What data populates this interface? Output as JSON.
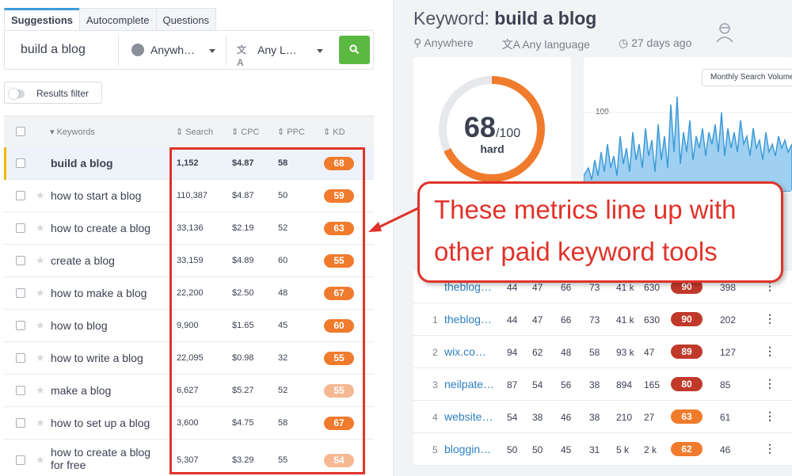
{
  "tabs": [
    "Suggestions",
    "Autocomplete",
    "Questions"
  ],
  "search": {
    "keyword": "build a blog",
    "location": "Anywh…",
    "language": "Any L…"
  },
  "filter_label": "Results filter",
  "table_headers": {
    "keywords": "Keywords",
    "search": "Search",
    "cpc": "CPC",
    "ppc": "PPC",
    "kd": "KD"
  },
  "rows": [
    {
      "keyword": "build a blog",
      "search": "1,152",
      "cpc": "$4.87",
      "ppc": "58",
      "kd": "68"
    },
    {
      "keyword": "how to start a blog",
      "search": "110,387",
      "cpc": "$4.87",
      "ppc": "50",
      "kd": "59"
    },
    {
      "keyword": "how to create a blog",
      "search": "33,136",
      "cpc": "$2.19",
      "ppc": "52",
      "kd": "63"
    },
    {
      "keyword": "create a blog",
      "search": "33,159",
      "cpc": "$4.89",
      "ppc": "60",
      "kd": "55"
    },
    {
      "keyword": "how to make a blog",
      "search": "22,200",
      "cpc": "$2.50",
      "ppc": "48",
      "kd": "67"
    },
    {
      "keyword": "how to blog",
      "search": "9,900",
      "cpc": "$1.65",
      "ppc": "45",
      "kd": "60"
    },
    {
      "keyword": "how to write a blog",
      "search": "22,095",
      "cpc": "$0.98",
      "ppc": "32",
      "kd": "55"
    },
    {
      "keyword": "make a blog",
      "search": "6,627",
      "cpc": "$5.27",
      "ppc": "52",
      "kd": "55"
    },
    {
      "keyword": "how to set up a blog",
      "search": "3,600",
      "cpc": "$4.75",
      "ppc": "58",
      "kd": "67"
    },
    {
      "keyword_line1": "how to create a blog",
      "keyword_line2": "for free",
      "search": "5,307",
      "cpc": "$3.29",
      "ppc": "55",
      "kd": "54"
    }
  ],
  "right": {
    "title_prefix": "Keyword:",
    "title_keyword": "build a blog",
    "location": "Anywhere",
    "language": "Any language",
    "updated": "27 days ago",
    "difficulty": "68",
    "difficulty_max": "/100",
    "difficulty_word": "hard",
    "chart_button": "Monthly Search Volume",
    "chart_tick": "100"
  },
  "serp": [
    {
      "rank": "",
      "domain": "theblog…",
      "v": [
        "44",
        "47",
        "66",
        "73",
        "41 k",
        "630"
      ],
      "badge": "90",
      "last": "398"
    },
    {
      "rank": "1",
      "domain": "theblog…",
      "v": [
        "44",
        "47",
        "66",
        "73",
        "41 k",
        "630"
      ],
      "badge": "90",
      "last": "202"
    },
    {
      "rank": "2",
      "domain": "wix.co…",
      "v": [
        "94",
        "62",
        "48",
        "58",
        "93 k",
        "47"
      ],
      "badge": "89",
      "last": "127"
    },
    {
      "rank": "3",
      "domain": "neilpate…",
      "v": [
        "87",
        "54",
        "56",
        "38",
        "894",
        "165"
      ],
      "badge": "80",
      "last": "85"
    },
    {
      "rank": "4",
      "domain": "website…",
      "v": [
        "54",
        "38",
        "46",
        "38",
        "210",
        "27"
      ],
      "badge": "63",
      "last": "61"
    },
    {
      "rank": "5",
      "domain": "bloggin…",
      "v": [
        "50",
        "50",
        "45",
        "31",
        "5 k",
        "2 k"
      ],
      "badge": "62",
      "last": "46"
    }
  ],
  "callout": {
    "line1": "These metrics line up with",
    "line2": "other paid keyword tools"
  },
  "colors": {
    "green": "#5bb843",
    "orange": "#f07b2c",
    "red": "#e0332a",
    "blue": "#3e9bd8"
  }
}
